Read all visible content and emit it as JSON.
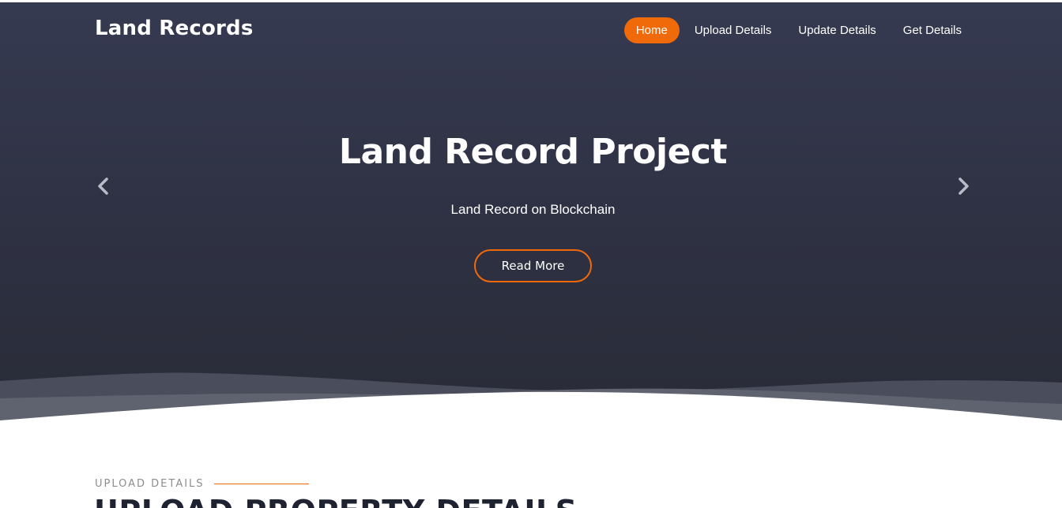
{
  "brand": {
    "title": "Land Records"
  },
  "nav": {
    "items": [
      {
        "label": "Home",
        "active": true
      },
      {
        "label": "Upload Details",
        "active": false
      },
      {
        "label": "Update Details",
        "active": false
      },
      {
        "label": "Get Details",
        "active": false
      }
    ]
  },
  "hero": {
    "title": "Land Record Project",
    "subtitle": "Land Record on Blockchain",
    "button_label": "Read More",
    "prev_icon": "chevron-left-icon",
    "next_icon": "chevron-right-icon"
  },
  "section": {
    "label": "UPLOAD DETAILS",
    "heading": "UPLOAD PROPERTY DETAILS"
  },
  "colors": {
    "accent": "#f16a0a",
    "hero_bg_top": "#363a51",
    "hero_bg_bottom": "#292b37",
    "text_light": "#ffffff",
    "heading_dark": "#1f2230",
    "label_gray": "#8d8d8d"
  }
}
